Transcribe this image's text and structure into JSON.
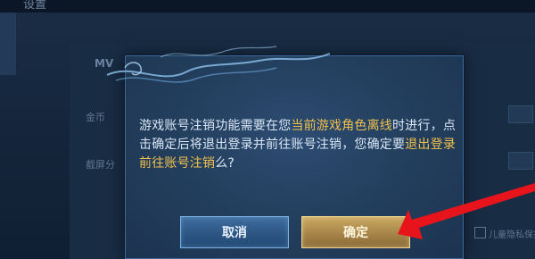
{
  "background": {
    "title": "设置",
    "section_label": "MV",
    "row1_label": "金币",
    "row2_label": "截屏分",
    "footer_text": "儿童隐私保护"
  },
  "dialog": {
    "message_part1": "游戏账号注销功能需要在您",
    "message_highlight1": "当前游戏角色离线",
    "message_part2": "时进行，点击确定后将退出登录并前往账号注销，您确定要",
    "message_highlight2": "退出登录前往账号注销",
    "message_part3": "么?",
    "cancel_label": "取消",
    "confirm_label": "确定"
  },
  "colors": {
    "highlight": "#f1c14d",
    "arrow": "#e8141c",
    "dialog_bg": "#24405f"
  }
}
